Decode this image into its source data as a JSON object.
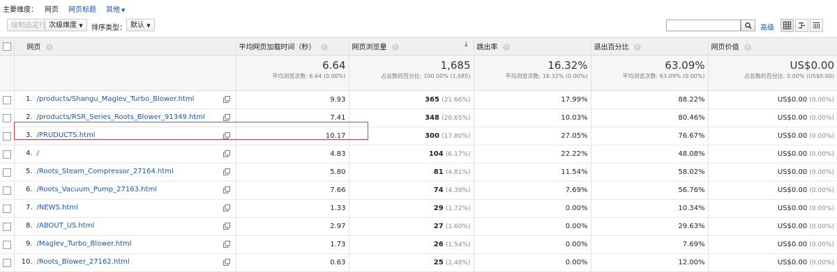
{
  "dimension_bar": {
    "label": "主要维度：",
    "active": "网页",
    "links": [
      "网页标题",
      "其他"
    ]
  },
  "toolbar": {
    "plot_rows": "绘制选定行",
    "secondary_dim": "次级维度",
    "sort_type_label": "排序类型：",
    "sort_type_value": "默认",
    "search_value": "",
    "advanced": "高级"
  },
  "table": {
    "headers": [
      "网页",
      "平均网页加载时间（秒）",
      "网页浏览量",
      "跳出率",
      "退出百分比",
      "网页价值"
    ],
    "summary": [
      {
        "value": "6.64",
        "sub": "平均浏览次数: 6.64 (0.00%)"
      },
      {
        "value": "1,685",
        "sub": "占总数的百分比: 100.00% (1,685)"
      },
      {
        "value": "16.32%",
        "sub": "平均浏览次数: 16.32% (0.00%)"
      },
      {
        "value": "63.09%",
        "sub": "平均浏览次数: 63.09% (0.00%)"
      },
      {
        "value": "US$0.00",
        "sub": "占总数的百分比: 0.00% (US$0.00)"
      }
    ],
    "rows": [
      {
        "idx": "1.",
        "page": "/products/Shangu_Maglev_Turbo_Blower.html",
        "load": "9.93",
        "views": "365",
        "views_pct": "(21.66%)",
        "bounce": "17.99%",
        "exit": "88.22%",
        "value": "US$0.00",
        "value_pct": "(0.00%)"
      },
      {
        "idx": "2.",
        "page": "/products/RSR_Series_Roots_Blower_91349.html",
        "load": "7.41",
        "views": "348",
        "views_pct": "(20.65%)",
        "bounce": "10.03%",
        "exit": "80.46%",
        "value": "US$0.00",
        "value_pct": "(0.00%)"
      },
      {
        "idx": "3.",
        "page": "/PRUDUCTS.html",
        "load": "10.17",
        "views": "300",
        "views_pct": "(17.80%)",
        "bounce": "27.05%",
        "exit": "76.67%",
        "value": "US$0.00",
        "value_pct": "(0.00%)"
      },
      {
        "idx": "4.",
        "page": "/",
        "load": "4.83",
        "views": "104",
        "views_pct": "(6.17%)",
        "bounce": "22.22%",
        "exit": "48.08%",
        "value": "US$0.00",
        "value_pct": "(0.00%)"
      },
      {
        "idx": "5.",
        "page": "/Roots_Steam_Compressor_27164.html",
        "load": "5.80",
        "views": "81",
        "views_pct": "(4.81%)",
        "bounce": "11.54%",
        "exit": "58.02%",
        "value": "US$0.00",
        "value_pct": "(0.00%)"
      },
      {
        "idx": "6.",
        "page": "/Roots_Vacuum_Pump_27163.html",
        "load": "7.66",
        "views": "74",
        "views_pct": "(4.39%)",
        "bounce": "7.69%",
        "exit": "56.76%",
        "value": "US$0.00",
        "value_pct": "(0.00%)"
      },
      {
        "idx": "7.",
        "page": "/NEWS.html",
        "load": "1.33",
        "views": "29",
        "views_pct": "(1.72%)",
        "bounce": "0.00%",
        "exit": "10.34%",
        "value": "US$0.00",
        "value_pct": "(0.00%)"
      },
      {
        "idx": "8.",
        "page": "/ABOUT_US.html",
        "load": "2.97",
        "views": "27",
        "views_pct": "(1.60%)",
        "bounce": "0.00%",
        "exit": "29.63%",
        "value": "US$0.00",
        "value_pct": "(0.00%)"
      },
      {
        "idx": "9.",
        "page": "/Maglev_Turbo_Blower.html",
        "load": "1.73",
        "views": "26",
        "views_pct": "(1.54%)",
        "bounce": "0.00%",
        "exit": "7.69%",
        "value": "US$0.00",
        "value_pct": "(0.00%)"
      },
      {
        "idx": "10.",
        "page": "/Roots_Blower_27162.html",
        "load": "0.63",
        "views": "25",
        "views_pct": "(1.48%)",
        "bounce": "0.00%",
        "exit": "12.00%",
        "value": "US$0.00",
        "value_pct": "(0.00%)"
      }
    ]
  },
  "colors": {
    "link": "#1a55b8",
    "highlight": "#e23a3a",
    "header_bg": "#f0f0f0"
  },
  "icons": {
    "search": "search-icon",
    "external": "external-link-icon",
    "help": "help-icon",
    "sort": "sort-desc-icon"
  }
}
